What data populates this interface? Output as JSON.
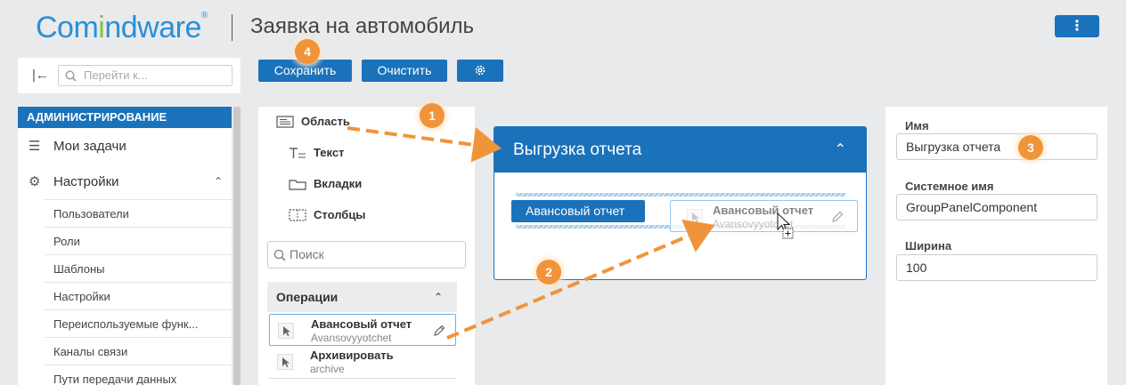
{
  "header": {
    "logo_part1": "Com",
    "logo_part2": "i",
    "logo_part3": "ndware",
    "logo_mark": "®",
    "title": "Заявка на автомобиль",
    "menu_label": "⋮"
  },
  "nav_search": {
    "placeholder": "Перейти к..."
  },
  "toolbar": {
    "save_label": "Сохранить",
    "clear_label": "Очистить",
    "settings_icon": "gear-icon"
  },
  "sidebar": {
    "section": "АДМИНИСТРИРОВАНИЕ",
    "main_items": [
      {
        "label": "Мои задачи",
        "icon": "tasks-icon"
      },
      {
        "label": "Настройки",
        "icon": "gear-icon"
      }
    ],
    "sub_items": [
      {
        "label": "Пользователи"
      },
      {
        "label": "Роли"
      },
      {
        "label": "Шаблоны"
      },
      {
        "label": "Настройки"
      },
      {
        "label": "Переиспользуемые функ..."
      },
      {
        "label": "Каналы связи"
      },
      {
        "label": "Пути передачи данных"
      }
    ]
  },
  "palette": {
    "items": [
      {
        "label": "Область",
        "icon": "area-icon"
      },
      {
        "label": "Текст",
        "icon": "text-icon"
      },
      {
        "label": "Вкладки",
        "icon": "tabs-icon"
      },
      {
        "label": "Столбцы",
        "icon": "columns-icon"
      }
    ],
    "search_placeholder": "Поиск",
    "operations_header": "Операции",
    "operations": [
      {
        "title": "Авансовый отчет",
        "system": "Avansovyyotchet"
      },
      {
        "title": "Архивировать",
        "system": "archive"
      }
    ]
  },
  "canvas": {
    "group_title": "Выгрузка отчета",
    "chip_label": "Авансовый отчет",
    "ghost_title": "Авансовый отчет",
    "ghost_sub": "Avansovyyotchet"
  },
  "properties": {
    "name_label": "Имя",
    "name_value": "Выгрузка отчета",
    "system_label": "Системное имя",
    "system_value": "GroupPanelComponent",
    "width_label": "Ширина",
    "width_value": "100"
  },
  "badges": [
    "1",
    "2",
    "3",
    "4"
  ],
  "colors": {
    "primary": "#1a72bb",
    "accent": "#f0943a",
    "logo_blue": "#2a8fd8",
    "logo_green": "#8cbf3f"
  }
}
